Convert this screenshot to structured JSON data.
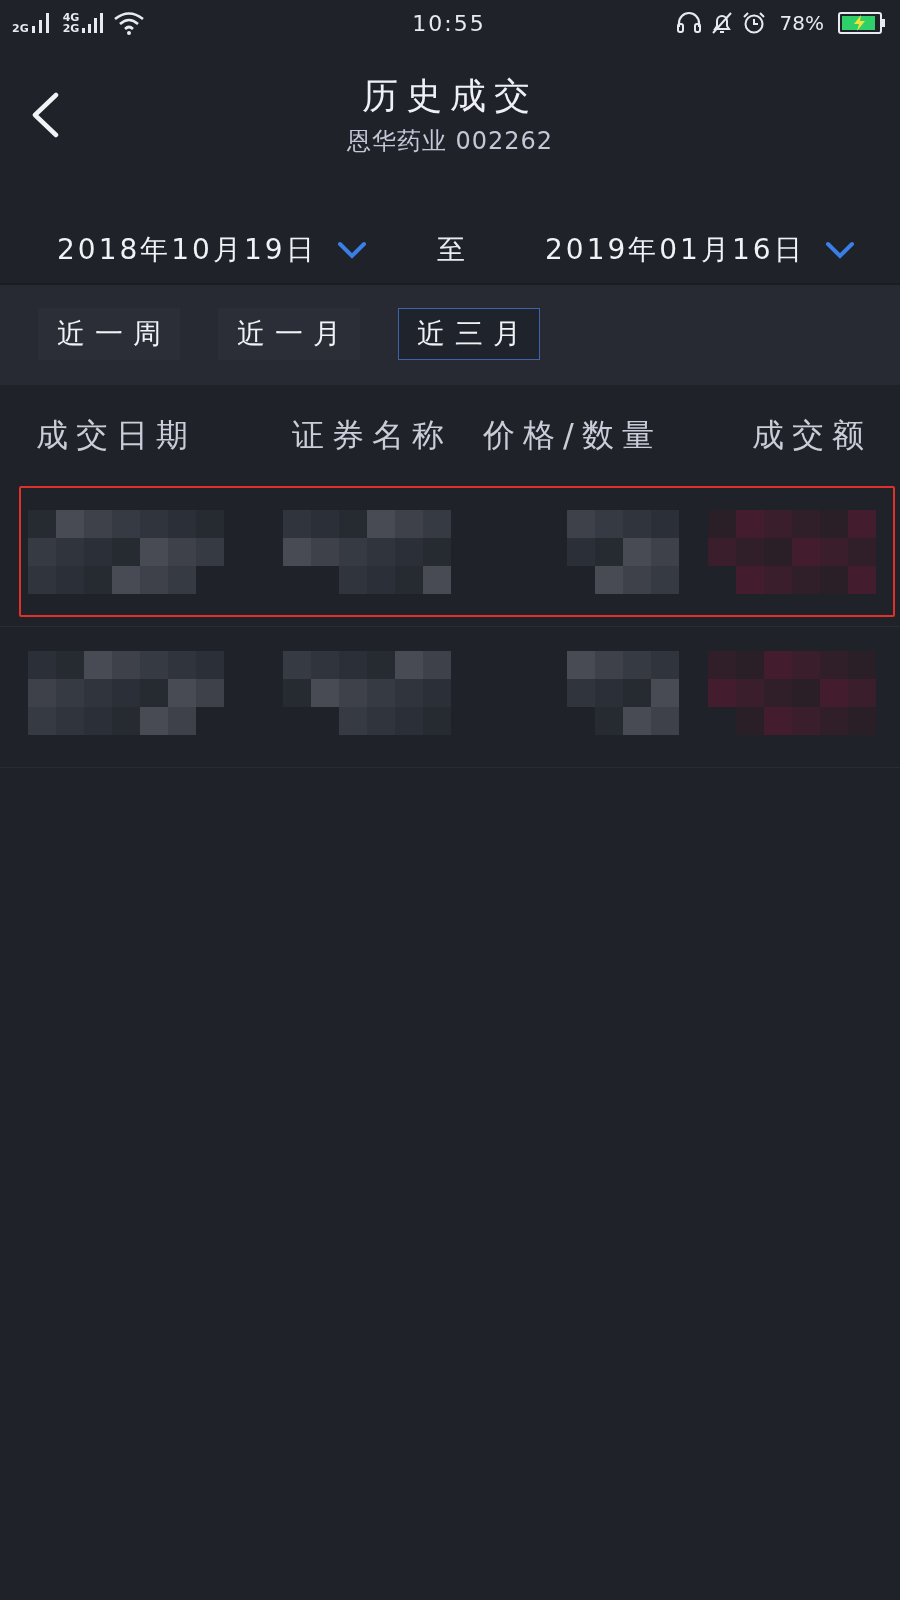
{
  "status_bar": {
    "signals": [
      {
        "labels": [
          "2G"
        ]
      },
      {
        "labels": [
          "4G",
          "2G"
        ]
      }
    ],
    "time": "10:55",
    "battery_text": "78%",
    "charging": true
  },
  "header": {
    "title": "历史成交",
    "subtitle": "恩华药业 002262"
  },
  "date_range": {
    "start": "2018年10月19日",
    "separator": "至",
    "end": "2019年01月16日"
  },
  "quick_ranges": [
    {
      "label": "近一周",
      "selected": false
    },
    {
      "label": "近一月",
      "selected": false
    },
    {
      "label": "近三月",
      "selected": true
    }
  ],
  "table": {
    "columns": [
      "成交日期",
      "证券名称",
      "价格/数量",
      "成交额"
    ],
    "rows": [
      {
        "kind": "pixelated",
        "highlighted": true
      },
      {
        "kind": "pixelated",
        "highlighted": false
      }
    ]
  }
}
